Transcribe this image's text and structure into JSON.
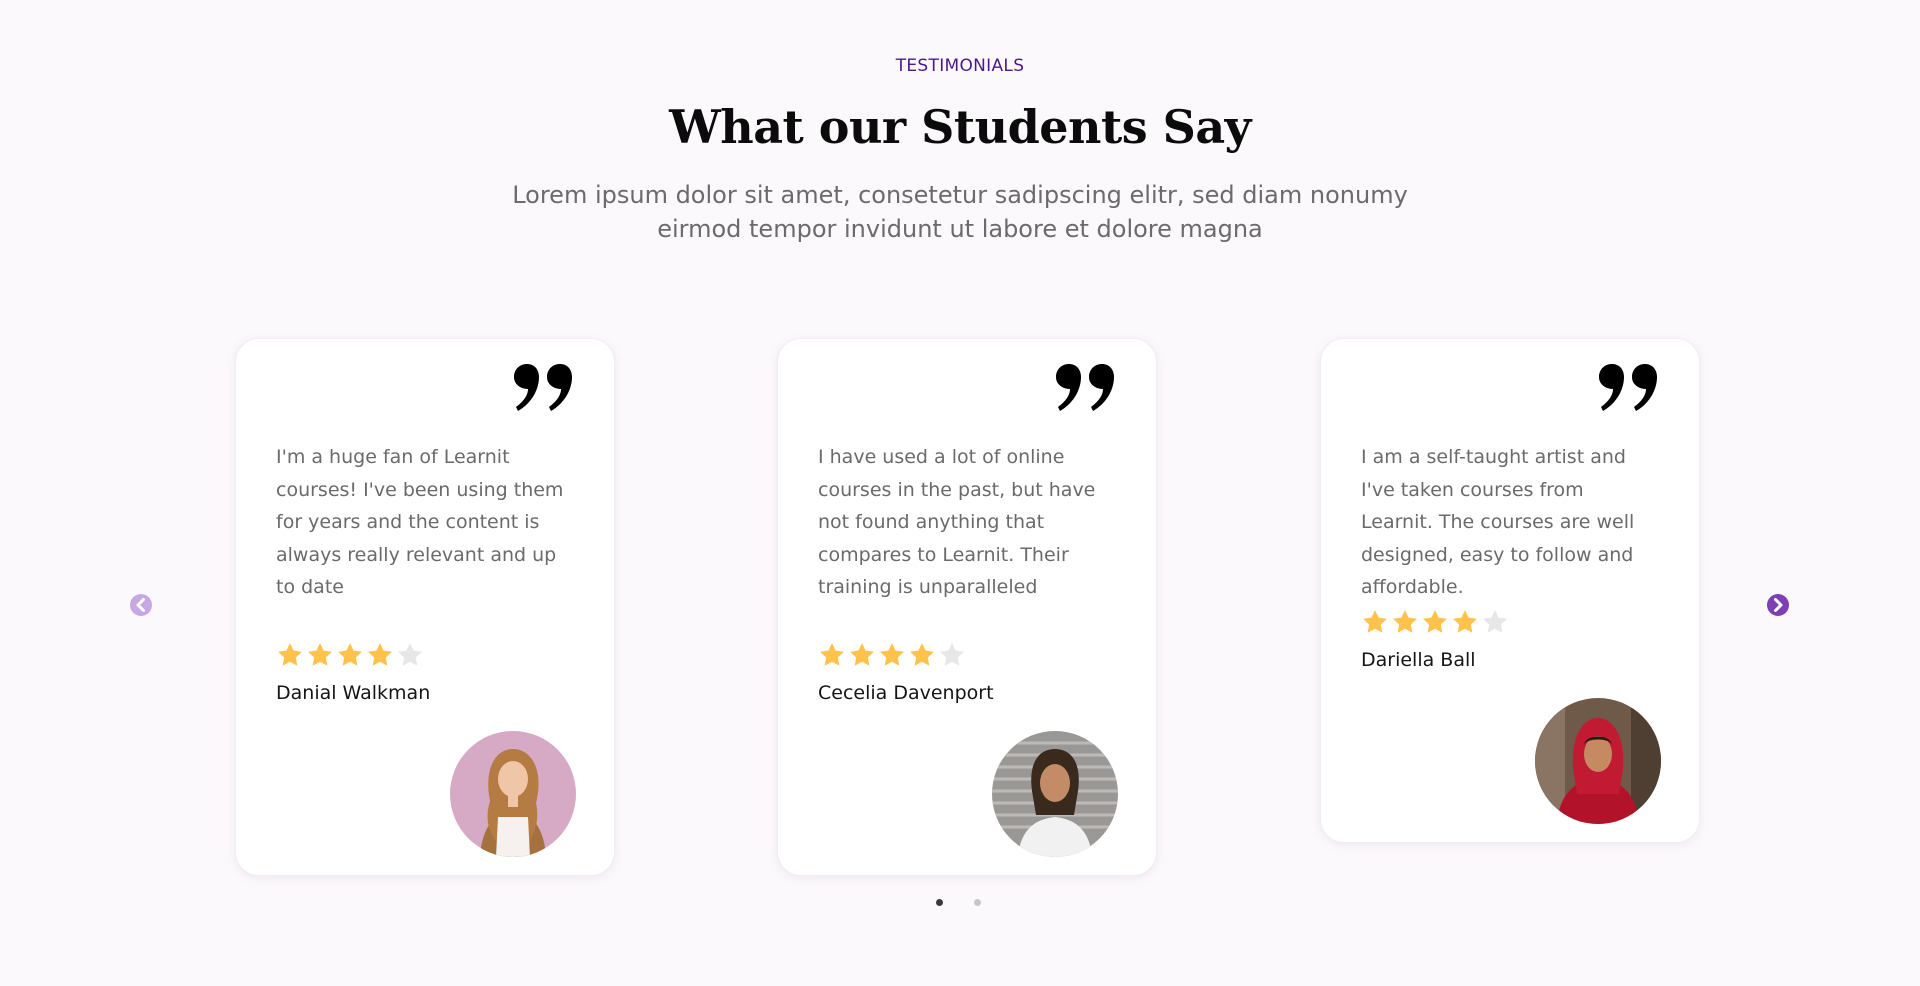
{
  "header": {
    "eyebrow": "TESTIMONIALS",
    "title": "What our Students Say",
    "subtitle": "Lorem ipsum dolor sit amet, consetetur sadipscing elitr, sed diam nonumy eirmod tempor invidunt ut labore et dolore magna"
  },
  "testimonials": [
    {
      "quote": "I'm a huge fan of Learnit courses! I've been using them for years and the content is always really relevant and up to date",
      "rating": 4,
      "max_rating": 5,
      "name": "Danial Walkman"
    },
    {
      "quote": "I have used a lot of online courses in the past, but have not found anything that compares to Learnit. Their training is unparalleled",
      "rating": 4,
      "max_rating": 5,
      "name": "Cecelia Davenport"
    },
    {
      "quote": "I am a self-taught artist and I've taken courses from Learnit. The courses are well designed, easy to follow and affordable.",
      "rating": 4,
      "max_rating": 5,
      "name": "Dariella Ball"
    }
  ],
  "carousel": {
    "prev_icon": "chevron-left-circle-icon",
    "next_icon": "chevron-right-circle-icon",
    "page_count": 2,
    "active_page": 1
  },
  "colors": {
    "accent": "#7d3fb5",
    "eyebrow": "#4a1a8a",
    "star_filled": "#ffc24a",
    "star_empty": "#e7e7e7",
    "background": "#fcf9fc"
  }
}
